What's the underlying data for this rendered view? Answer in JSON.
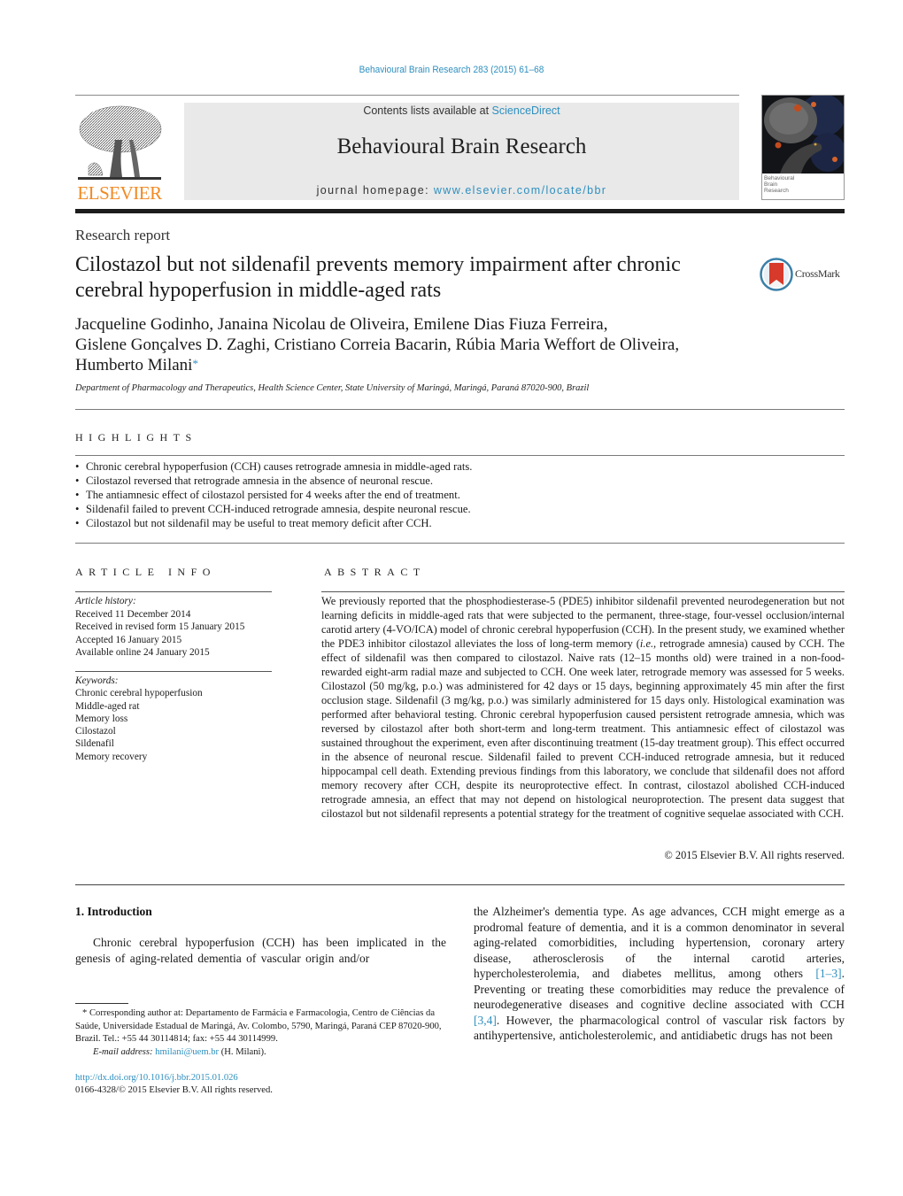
{
  "header": {
    "journal_ref": "Behavioural Brain Research 283 (2015) 61–68",
    "contents_prefix": "Contents lists available at ",
    "contents_link": "ScienceDirect",
    "journal_title": "Behavioural Brain Research",
    "homepage_prefix": "journal homepage: ",
    "homepage_link": "www.elsevier.com/locate/bbr",
    "publisher_logo_text": "ELSEVIER",
    "cover_label": [
      "Behavioural",
      "Brain",
      "Research"
    ],
    "colors": {
      "link": "#2e8fbf",
      "elsevier_orange": "#f08a24",
      "masthead_bg": "#e9e9e9"
    }
  },
  "article": {
    "type": "Research report",
    "title": "Cilostazol but not sildenafil prevents memory impairment after chronic cerebral hypoperfusion in middle-aged rats",
    "crossmark_label": "CrossMark",
    "authors_line1": "Jacqueline Godinho, Janaina Nicolau de Oliveira, Emilene Dias Fiuza Ferreira,",
    "authors_line2": "Gislene Gonçalves D. Zaghi, Cristiano Correia Bacarin, Rúbia Maria Weffort de Oliveira,",
    "authors_line3": "Humberto Milani",
    "corresponding_marker": "*",
    "affiliation": "Department of Pharmacology and Therapeutics, Health Science Center, State University of Maringá, Maringá, Paraná 87020-900, Brazil"
  },
  "highlights": {
    "heading": "HIGHLIGHTS",
    "items": [
      "Chronic cerebral hypoperfusion (CCH) causes retrograde amnesia in middle-aged rats.",
      "Cilostazol reversed that retrograde amnesia in the absence of neuronal rescue.",
      "The antiamnesic effect of cilostazol persisted for 4 weeks after the end of treatment.",
      "Sildenafil failed to prevent CCH-induced retrograde amnesia, despite neuronal rescue.",
      "Cilostazol but not sildenafil may be useful to treat memory deficit after CCH."
    ]
  },
  "article_info": {
    "heading": "ARTICLE INFO",
    "history_label": "Article history:",
    "history": [
      "Received 11 December 2014",
      "Received in revised form 15 January 2015",
      "Accepted 16 January 2015",
      "Available online 24 January 2015"
    ],
    "keywords_label": "Keywords:",
    "keywords": [
      "Chronic cerebral hypoperfusion",
      "Middle-aged rat",
      "Memory loss",
      "Cilostazol",
      "Sildenafil",
      "Memory recovery"
    ]
  },
  "abstract": {
    "heading": "ABSTRACT",
    "part1": "We previously reported that the phosphodiesterase-5 (PDE5) inhibitor sildenafil prevented neurodegen­eration but not learning deficits in middle-aged rats that were subjected to the permanent, three-stage, four-vessel occlusion/internal carotid artery (4-VO/ICA) model of chronic cerebral hypoperfusion (CCH). In the present study, we examined whether the PDE3 inhibitor cilostazol alleviates the loss of long-term memory (",
    "ie": "i.e.",
    "part2": ", retrograde amnesia) caused by CCH. The effect of sildenafil was then compared to cilosta­zol. Naive rats (12–15 months old) were trained in a non-food-rewarded eight-arm radial maze and subjected to CCH. One week later, retrograde memory was assessed for 5 weeks. Cilostazol (50 mg/kg, p.o.) was administered for 42 days or 15 days, beginning approximately 45 min after the first occlusion stage. Sildenafil (3 mg/kg, p.o.) was similarly administered for 15 days only. Histological examination was performed after behavioral testing. Chronic cerebral hypoperfusion caused persistent retrograde amne­sia, which was reversed by cilostazol after both short-term and long-term treatment. This antiamnesic effect of cilostazol was sustained throughout the experiment, even after discontinuing treatment (15-day treatment group). This effect occurred in the absence of neuronal rescue. Sildenafil failed to prevent CCH-induced retrograde amnesia, but it reduced hippocampal cell death. Extending previous findings from this laboratory, we conclude that sildenafil does not afford memory recovery after CCH, despite its neuroprotective effect. In contrast, cilostazol abolished CCH-induced retrograde amnesia, an effect that may not depend on histological neuroprotection. The present data suggest that cilostazol but not sildenafil represents a potential strategy for the treatment of cognitive sequelae associated with CCH.",
    "copyright": "© 2015 Elsevier B.V. All rights reserved."
  },
  "introduction": {
    "heading": "1.  Introduction",
    "left_para": "Chronic cerebral hypoperfusion (CCH) has been implicated in the genesis of aging-related dementia of vascular origin and/or",
    "right_part1": "the Alzheimer's dementia type. As age advances, CCH might emerge as a prodromal feature of dementia, and it is a com­mon denominator in several aging-related comorbidities, including hypertension, coronary artery disease, atherosclerosis of the inter­nal carotid arteries, hypercholesterolemia, and diabetes mellitus, among others ",
    "ref1": "[1–3]",
    "right_part2": ". Preventing or treating these comorbidi­ties may reduce the prevalence of neurodegenerative diseases and cognitive decline associated with CCH ",
    "ref2": "[3,4]",
    "right_part3": ". However, the pharmacological control of vascular risk factors by antihyperten­sive, anticholesterolemic, and antidiabetic drugs has not been"
  },
  "footnote": {
    "marker": "*",
    "text": "Corresponding author at: Departamento de Farmácia e Farmacologia, Centro de Ciências da Saúde, Universidade Estadual de Maringá, Av. Colombo, 5790, Maringá, Paraná CEP 87020-900, Brazil. Tel.: +55 44 30114814; fax: +55 44 30114999.",
    "email_label": "E-mail address:",
    "email": "hmilani@uem.br",
    "email_suffix": " (H. Milani).",
    "doi": "http://dx.doi.org/10.1016/j.bbr.2015.01.026",
    "issn": "0166-4328/© 2015 Elsevier B.V. All rights reserved."
  }
}
